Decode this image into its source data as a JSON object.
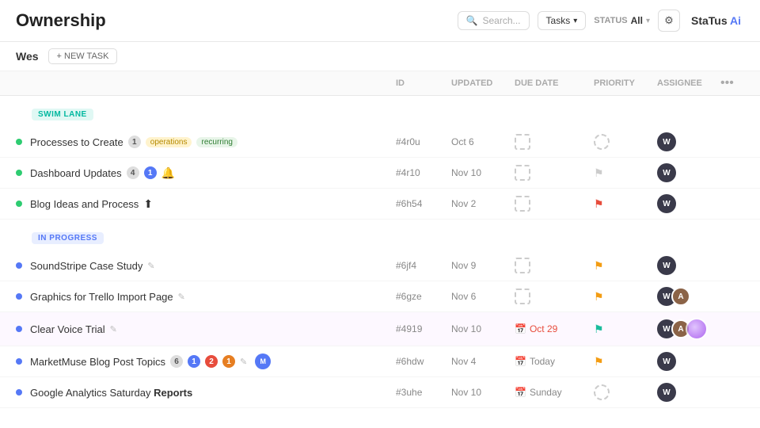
{
  "header": {
    "title": "Ownership",
    "search_placeholder": "Search...",
    "tasks_dropdown_label": "Tasks",
    "status_label": "STATUS",
    "status_value": "All",
    "status_ai": "StaTus Ai"
  },
  "sub_header": {
    "user": "Wes",
    "new_task_label": "+ NEW TASK"
  },
  "table_columns": {
    "id": "ID",
    "updated": "UPDATED",
    "due_date": "DUE DATE",
    "priority": "PRIORITY",
    "assignee": "ASSIGNEE"
  },
  "sections": [
    {
      "label": "SWIM LANE",
      "type": "swim-lane",
      "tasks": [
        {
          "name": "Processes to Create",
          "badge": "1",
          "tags": [
            "operations",
            "recurring"
          ],
          "id": "#4r0u",
          "updated": "Oct 6",
          "due_date": "",
          "due_type": "dashed",
          "priority": "dashed",
          "assignee_type": "single"
        },
        {
          "name": "Dashboard Updates",
          "badge_gray": "4",
          "badge_blue": "1",
          "has_notify": true,
          "id": "#4r10",
          "updated": "Nov 10",
          "due_date": "",
          "due_type": "dashed",
          "priority": "flag-gray",
          "assignee_type": "single"
        },
        {
          "name": "Blog Ideas and Process",
          "has_icon": true,
          "id": "#6h54",
          "updated": "Nov 2",
          "due_date": "",
          "due_type": "dashed",
          "priority": "flag-red",
          "assignee_type": "single"
        }
      ]
    },
    {
      "label": "IN PROGRESS",
      "type": "in-progress",
      "tasks": [
        {
          "name": "SoundStripe Case Study",
          "has_edit": true,
          "id": "#6jf4",
          "updated": "Nov 9",
          "due_date": "",
          "due_type": "dashed",
          "priority": "flag-yellow",
          "assignee_type": "single"
        },
        {
          "name": "Graphics for Trello Import Page",
          "has_edit": true,
          "id": "#6gze",
          "updated": "Nov 6",
          "due_date": "",
          "due_type": "dashed",
          "priority": "flag-yellow",
          "assignee_type": "double"
        },
        {
          "name": "Clear Voice Trial",
          "has_edit": true,
          "id": "#4919",
          "updated": "Nov 10",
          "due_date": "Oct 29",
          "due_type": "overdue",
          "priority": "flag-teal",
          "assignee_type": "triple-blob"
        },
        {
          "name": "MarketMuse Blog Post Topics",
          "badge_gray": "6",
          "badges": [
            "1",
            "2",
            "1"
          ],
          "has_edit": true,
          "has_avatar_small": true,
          "id": "#6hdw",
          "updated": "Nov 4",
          "due_date": "Today",
          "due_type": "calendar",
          "priority": "flag-yellow",
          "assignee_type": "single"
        },
        {
          "name": "Google Analytics Saturday Reports",
          "id": "#3uhe",
          "updated": "Nov 10",
          "due_date": "Sunday",
          "due_type": "calendar",
          "priority": "dashed",
          "assignee_type": "single"
        }
      ]
    }
  ]
}
